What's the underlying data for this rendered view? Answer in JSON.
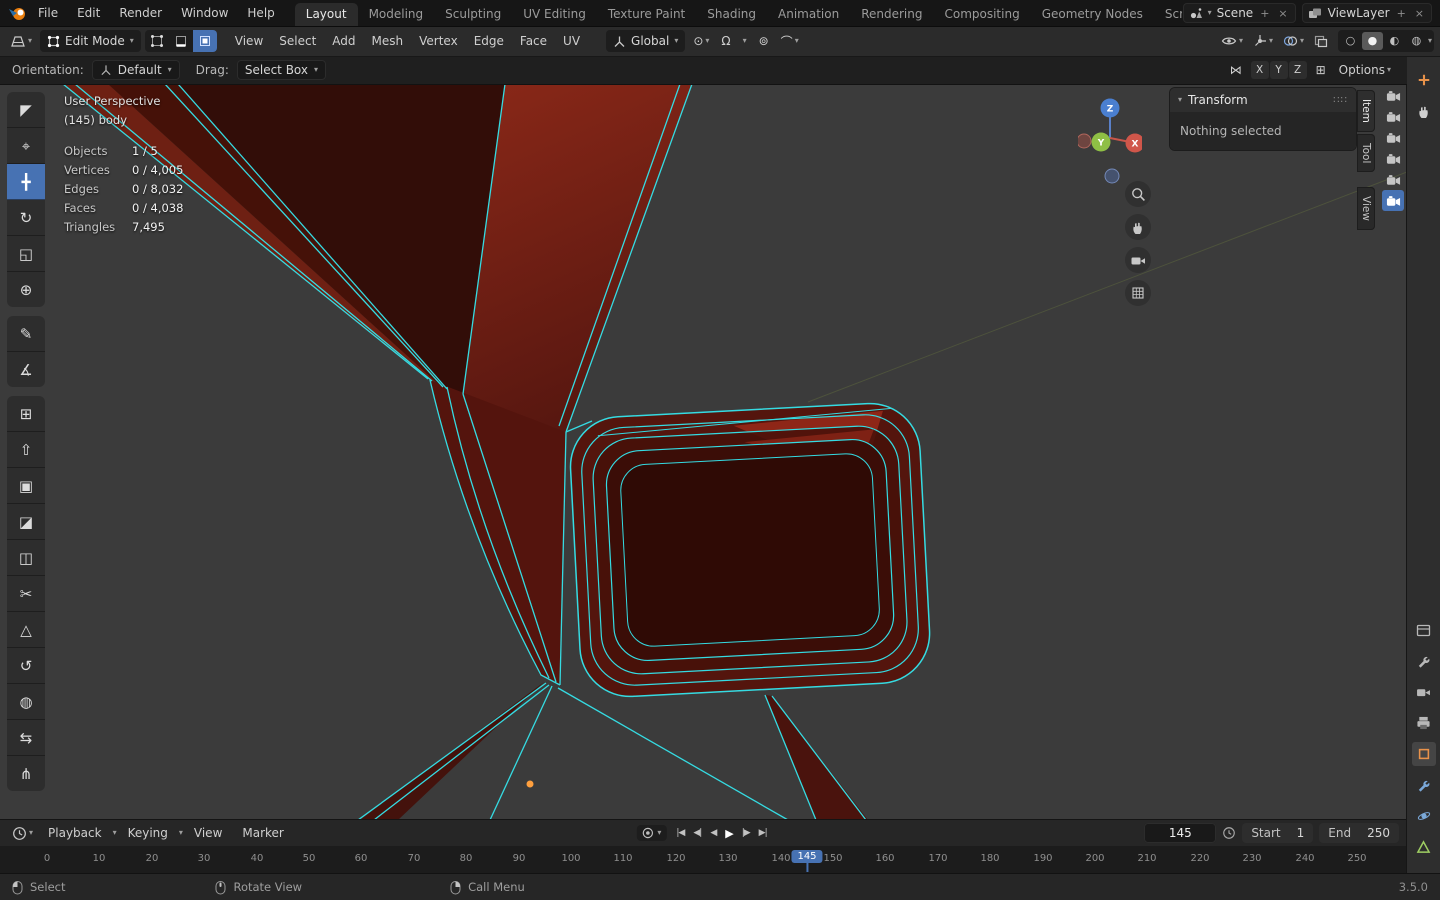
{
  "colors": {
    "accent": "#4772b3",
    "wireframe": "#35dbe2",
    "body_paint": "#6a1c10",
    "viewport_bg": "#3b3b3b"
  },
  "icons": {
    "chevron": "▾",
    "pivot": "⊙",
    "snap_magnet": "Ω",
    "proportional": "⊚",
    "falloff": "⌒",
    "wireframe": "○",
    "solid": "●",
    "material": "◐",
    "rendered": "◍",
    "mirror": "⋈",
    "snap_grid": "⊞",
    "drag_dots": "∷∷",
    "copy": "+",
    "close": "×"
  },
  "topbar": {
    "menus": [
      "File",
      "Edit",
      "Render",
      "Window",
      "Help"
    ],
    "workspaces": [
      "Layout",
      "Modeling",
      "Sculpting",
      "UV Editing",
      "Texture Paint",
      "Shading",
      "Animation",
      "Rendering",
      "Compositing",
      "Geometry Nodes",
      "Scripting"
    ],
    "scene": "Scene",
    "view_layer": "ViewLayer"
  },
  "header": {
    "mode": "Edit Mode",
    "menus": [
      "View",
      "Select",
      "Add",
      "Mesh",
      "Vertex",
      "Edge",
      "Face",
      "UV"
    ],
    "orientation": "Global"
  },
  "tool_settings": {
    "orientation_label": "Orientation:",
    "orientation_value": "Default",
    "drag_label": "Drag:",
    "drag_value": "Select Box",
    "axes": [
      "X",
      "Y",
      "Z"
    ],
    "options": "Options"
  },
  "tools": [
    {
      "name": "tweak",
      "glyph": "◤"
    },
    {
      "name": "cursor",
      "glyph": "⌖"
    },
    {
      "name": "move",
      "glyph": "╋"
    },
    {
      "name": "rotate",
      "glyph": "↻"
    },
    {
      "name": "scale",
      "glyph": "◱"
    },
    {
      "name": "transform",
      "glyph": "⊕"
    },
    {
      "name": "annotate",
      "glyph": "✎"
    },
    {
      "name": "measure",
      "glyph": "∡"
    },
    {
      "name": "add-cube",
      "glyph": "⊞"
    },
    {
      "name": "extrude-region",
      "glyph": "⇧"
    },
    {
      "name": "inset-faces",
      "glyph": "▣"
    },
    {
      "name": "bevel",
      "glyph": "◪"
    },
    {
      "name": "loop-cut",
      "glyph": "◫"
    },
    {
      "name": "knife",
      "glyph": "✂"
    },
    {
      "name": "poly-build",
      "glyph": "△"
    },
    {
      "name": "spin",
      "glyph": "↺"
    },
    {
      "name": "smooth",
      "glyph": "◍"
    },
    {
      "name": "edge-slide",
      "glyph": "⇆"
    },
    {
      "name": "rip-region",
      "glyph": "⋔"
    }
  ],
  "viewport": {
    "perspective": "User Perspective",
    "object": "(145) body",
    "stats": [
      {
        "label": "Objects",
        "value": "1 / 5"
      },
      {
        "label": "Vertices",
        "value": "0 / 4,005"
      },
      {
        "label": "Edges",
        "value": "0 / 8,032"
      },
      {
        "label": "Faces",
        "value": "0 / 4,038"
      },
      {
        "label": "Triangles",
        "value": "7,495"
      }
    ],
    "axis_labels": {
      "x": "X",
      "y": "Y",
      "z": "Z"
    }
  },
  "sidebar": {
    "panel_title": "Transform",
    "empty_text": "Nothing selected",
    "tabs": [
      "Item",
      "Tool",
      "View"
    ]
  },
  "timeline": {
    "menus": [
      "Playback",
      "Keying",
      "View",
      "Marker"
    ],
    "transport": [
      {
        "name": "jump-to-start",
        "glyph": "|◀"
      },
      {
        "name": "prev-keyframe",
        "glyph": "◀|"
      },
      {
        "name": "play-reverse",
        "glyph": "◀"
      },
      {
        "name": "play",
        "glyph": "▶"
      },
      {
        "name": "next-keyframe",
        "glyph": "|▶"
      },
      {
        "name": "jump-to-end",
        "glyph": "▶|"
      }
    ],
    "frame": "145",
    "playhead": "145",
    "start_label": "Start",
    "start_value": "1",
    "end_label": "End",
    "end_value": "250",
    "ticks": [
      "0",
      "10",
      "20",
      "30",
      "40",
      "50",
      "60",
      "70",
      "80",
      "90",
      "100",
      "110",
      "120",
      "130",
      "140",
      "150",
      "160",
      "170",
      "180",
      "190",
      "200",
      "210",
      "220",
      "230",
      "240",
      "250"
    ]
  },
  "statusbar": {
    "select": "Select",
    "rotate": "Rotate View",
    "call_menu": "Call Menu",
    "version": "3.5.0"
  }
}
